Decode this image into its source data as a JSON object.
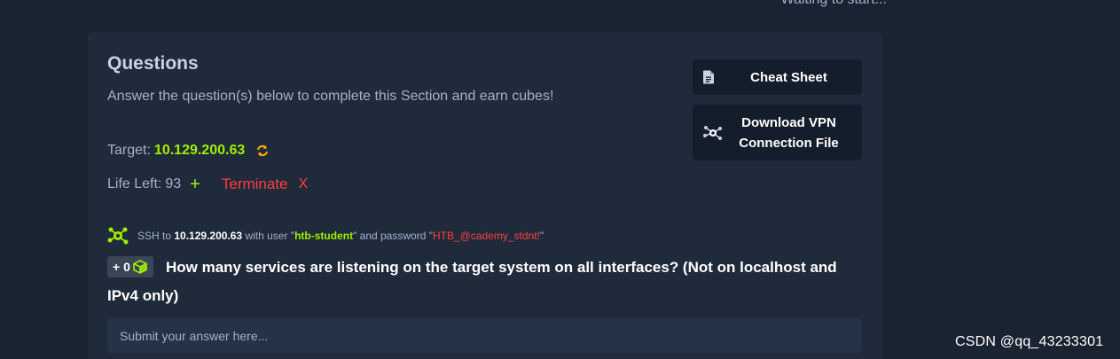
{
  "top_status": "Waiting to start...",
  "section": {
    "title": "Questions",
    "subtitle": "Answer the question(s) below to complete this Section and earn cubes!"
  },
  "target": {
    "label": "Target:",
    "ip": "10.129.200.63",
    "refresh_icon": "refresh-icon"
  },
  "life": {
    "label": "Life Left:",
    "value": "93",
    "plus_icon": "+",
    "terminate_label": "Terminate",
    "terminate_icon": "X"
  },
  "buttons": {
    "cheat_sheet": "Cheat Sheet",
    "download_vpn": "Download VPN Connection File"
  },
  "ssh": {
    "prefix": "SSH to",
    "ip": "10.129.200.63",
    "with_user": "with user \"",
    "user": "htb-student",
    "and_password": "\" and password \"",
    "password": "HTB_@cademy_stdnt!",
    "suffix": "\""
  },
  "question": {
    "reward": "+ 0",
    "text": "How many services are listening on the target system on all interfaces? (Not on localhost and IPv4 only)",
    "answer_placeholder": "Submit your answer here..."
  },
  "watermark": "CSDN @qq_43233301",
  "colors": {
    "background": "#1a2332",
    "card": "#1f2a3b",
    "accent_green": "#9fef00",
    "danger_red": "#ff3e3e",
    "muted_text": "#a4b1cd"
  }
}
